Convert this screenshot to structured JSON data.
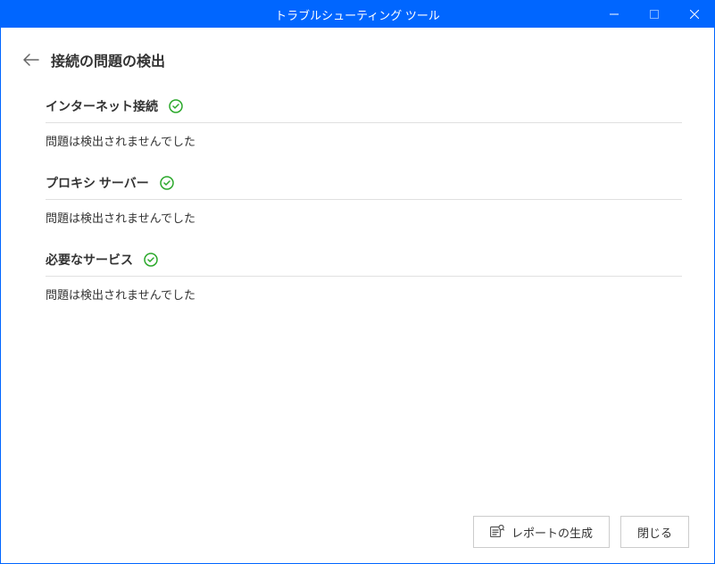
{
  "titlebar": {
    "title": "トラブルシューティング ツール"
  },
  "header": {
    "page_title": "接続の問題の検出"
  },
  "sections": [
    {
      "title": "インターネット接続",
      "status": "問題は検出されませんでした"
    },
    {
      "title": "プロキシ サーバー",
      "status": "問題は検出されませんでした"
    },
    {
      "title": "必要なサービス",
      "status": "問題は検出されませんでした"
    }
  ],
  "footer": {
    "report_label": "レポートの生成",
    "close_label": "閉じる"
  }
}
